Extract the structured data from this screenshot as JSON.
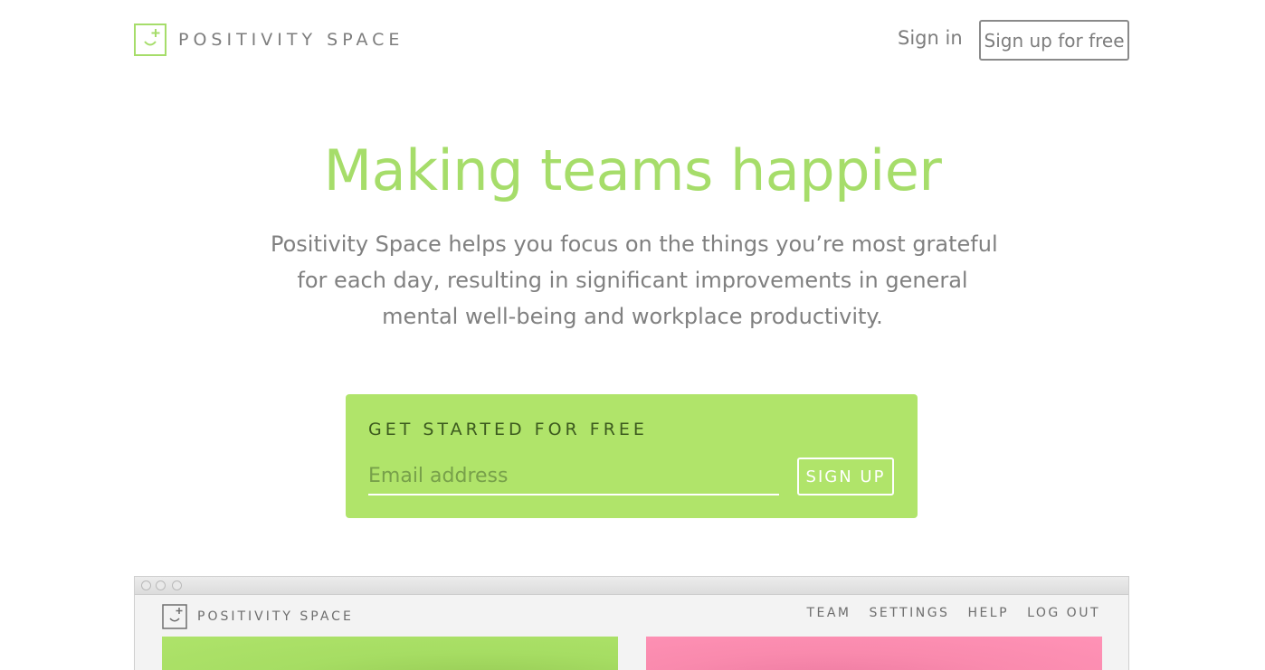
{
  "header": {
    "logo_text": "POSITIVITY SPACE",
    "sign_in": "Sign in",
    "sign_up": "Sign up for free"
  },
  "hero": {
    "title": "Making teams happier",
    "subtitle_lines": [
      "Positivity Space helps you focus on the things you’re most grateful",
      "for each day, resulting in significant improvements in general",
      "mental well-being and workplace productivity."
    ]
  },
  "signup": {
    "heading": "GET STARTED FOR FREE",
    "email_placeholder": "Email address",
    "button": "SIGN UP"
  },
  "preview": {
    "logo_text": "POSITIVITY SPACE",
    "nav": [
      "TEAM",
      "SETTINGS",
      "HELP",
      "LOG OUT"
    ]
  },
  "colors": {
    "brand_green": "#a6dd6a",
    "cta_green": "#b0e46a",
    "pink": "#ff92b6",
    "text_gray": "#7d7d7d"
  },
  "icons": {
    "logo": "smiley-plus-icon",
    "window_controls": "traffic-light-dots"
  }
}
